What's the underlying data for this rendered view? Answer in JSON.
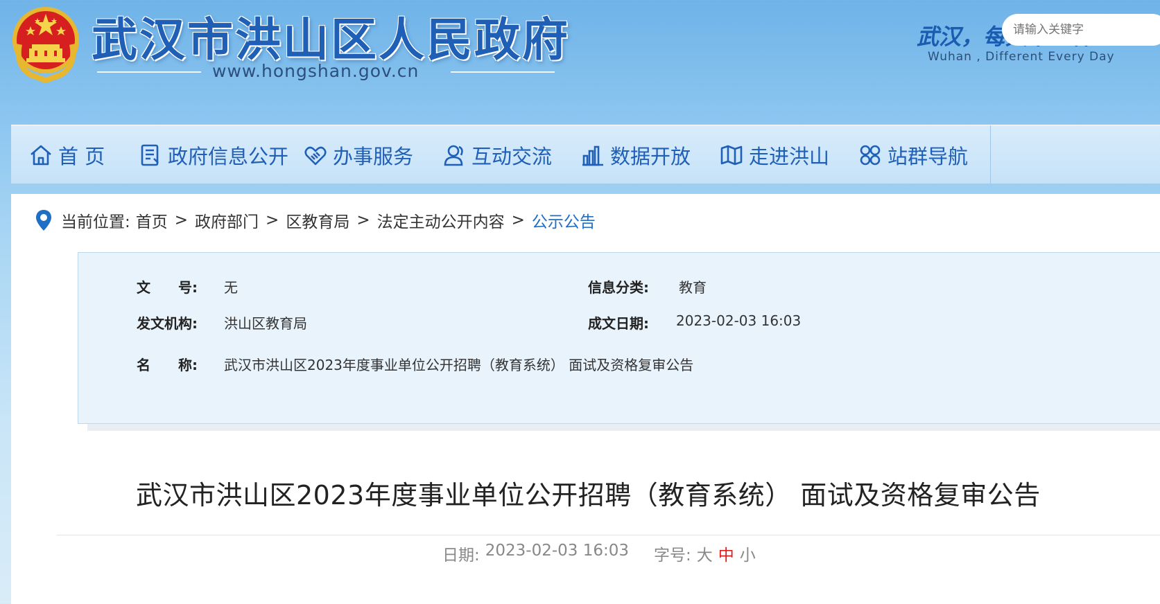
{
  "header": {
    "site_title": "武汉市洪山区人民政府",
    "site_url": "www.hongshan.gov.cn",
    "slogan": "武汉，每天不一样",
    "slogan_en": "Wuhan , Different Every Day"
  },
  "nav": {
    "items": [
      {
        "label": "首 页",
        "icon": "home-icon"
      },
      {
        "label": "政府信息公开",
        "icon": "document-icon"
      },
      {
        "label": "办事服务",
        "icon": "handshake-icon"
      },
      {
        "label": "互动交流",
        "icon": "users-icon"
      },
      {
        "label": "数据开放",
        "icon": "bar-chart-icon"
      },
      {
        "label": "走进洪山",
        "icon": "map-icon"
      },
      {
        "label": "站群导航",
        "icon": "grid-icon"
      }
    ],
    "search_placeholder": "请输入关键字"
  },
  "breadcrumb": {
    "prefix": "当前位置:",
    "items": [
      "首页",
      "政府部门",
      "区教育局",
      "法定主动公开内容",
      "公示公告"
    ],
    "separator": ">"
  },
  "info": {
    "doc_no_label": "文　　号:",
    "doc_no_value": "无",
    "category_label": "信息分类:",
    "category_value": "教育",
    "issuer_label": "发文机构:",
    "issuer_value": "洪山区教育局",
    "date_label": "成文日期:",
    "date_value": "2023-02-03 16:03",
    "name_label": "名　　称:",
    "name_value": "武汉市洪山区2023年度事业单位公开招聘（教育系统） 面试及资格复审公告"
  },
  "article": {
    "title": "武汉市洪山区2023年度事业单位公开招聘（教育系统） 面试及资格复审公告",
    "date_label": "日期:",
    "date_value": "2023-02-03 16:03",
    "font_label": "字号:",
    "font_sizes": [
      "大",
      "中",
      "小"
    ],
    "font_size_selected": "中"
  },
  "colors": {
    "brand_blue": "#1f5fb6",
    "link_blue": "#1f6fc5",
    "selected_red": "#d81e1e"
  }
}
